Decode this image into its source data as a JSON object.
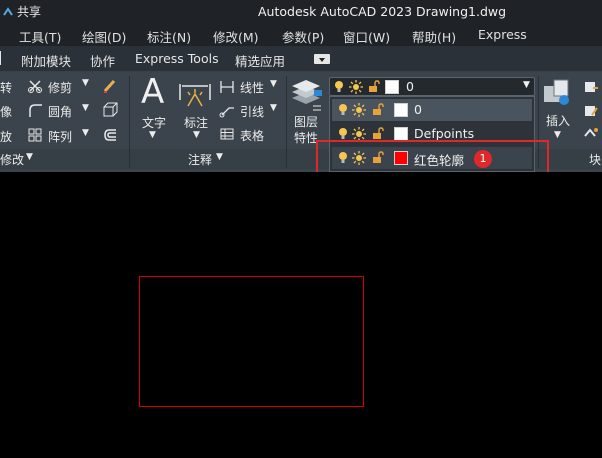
{
  "titlebar": {
    "share": "共享",
    "title": "Autodesk AutoCAD 2023    Drawing1.dwg"
  },
  "menu": [
    "工具(T)",
    "绘图(D)",
    "标注(N)",
    "修改(M)",
    "参数(P)",
    "窗口(W)",
    "帮助(H)",
    "Express"
  ],
  "tabs": [
    "附加模块",
    "协作",
    "Express Tools",
    "精选应用"
  ],
  "modify": {
    "rotate": "转",
    "trim": "修剪",
    "scale_frag": "像",
    "fillet": "圆角",
    "enlarge": "放",
    "array": "阵列",
    "panel": "修改"
  },
  "annotate": {
    "text": "文字",
    "dim": "标注",
    "linear": "线性",
    "leader": "引线",
    "table": "表格",
    "panel": "注释"
  },
  "layer": {
    "props": [
      "图层",
      "特性"
    ],
    "current": "0"
  },
  "layers": [
    {
      "name": "0",
      "color": "#ffffff"
    },
    {
      "name": "Defpoints",
      "color": "#ffffff"
    },
    {
      "name": "红色轮廓",
      "color": "#ff0000"
    }
  ],
  "insert": {
    "label": "插入",
    "block": "块"
  },
  "callout": {
    "badge": "1",
    "color": "#e0272b"
  },
  "drawing": {
    "rect_color": "#d40000"
  }
}
